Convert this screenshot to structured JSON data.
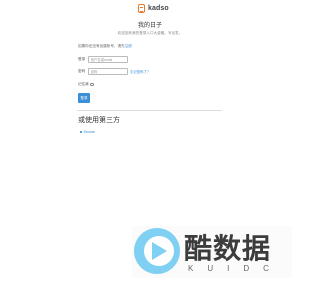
{
  "brand": {
    "name": "kadso",
    "accent": "#e8792b"
  },
  "header": {
    "title": "我的日子",
    "subtitle": "欢迎回来我的登录入口大金融。写出发。"
  },
  "intro": {
    "text": "如果你还没有创建帐号，请先",
    "link": "注册"
  },
  "form": {
    "username_label": "登录",
    "username_placeholder": "用户名或email",
    "password_label": "密码",
    "password_placeholder": "密码",
    "forgot_link": "忘记密码了？",
    "remember_label": "记住我",
    "submit_label": "登录"
  },
  "third_party": {
    "title": "或使用第三方",
    "items": [
      "Moocie"
    ]
  },
  "watermark": {
    "title": "酷数据",
    "sub": "KUIDC"
  },
  "colors": {
    "link": "#3b8fd6",
    "button": "#3b8fd6"
  }
}
